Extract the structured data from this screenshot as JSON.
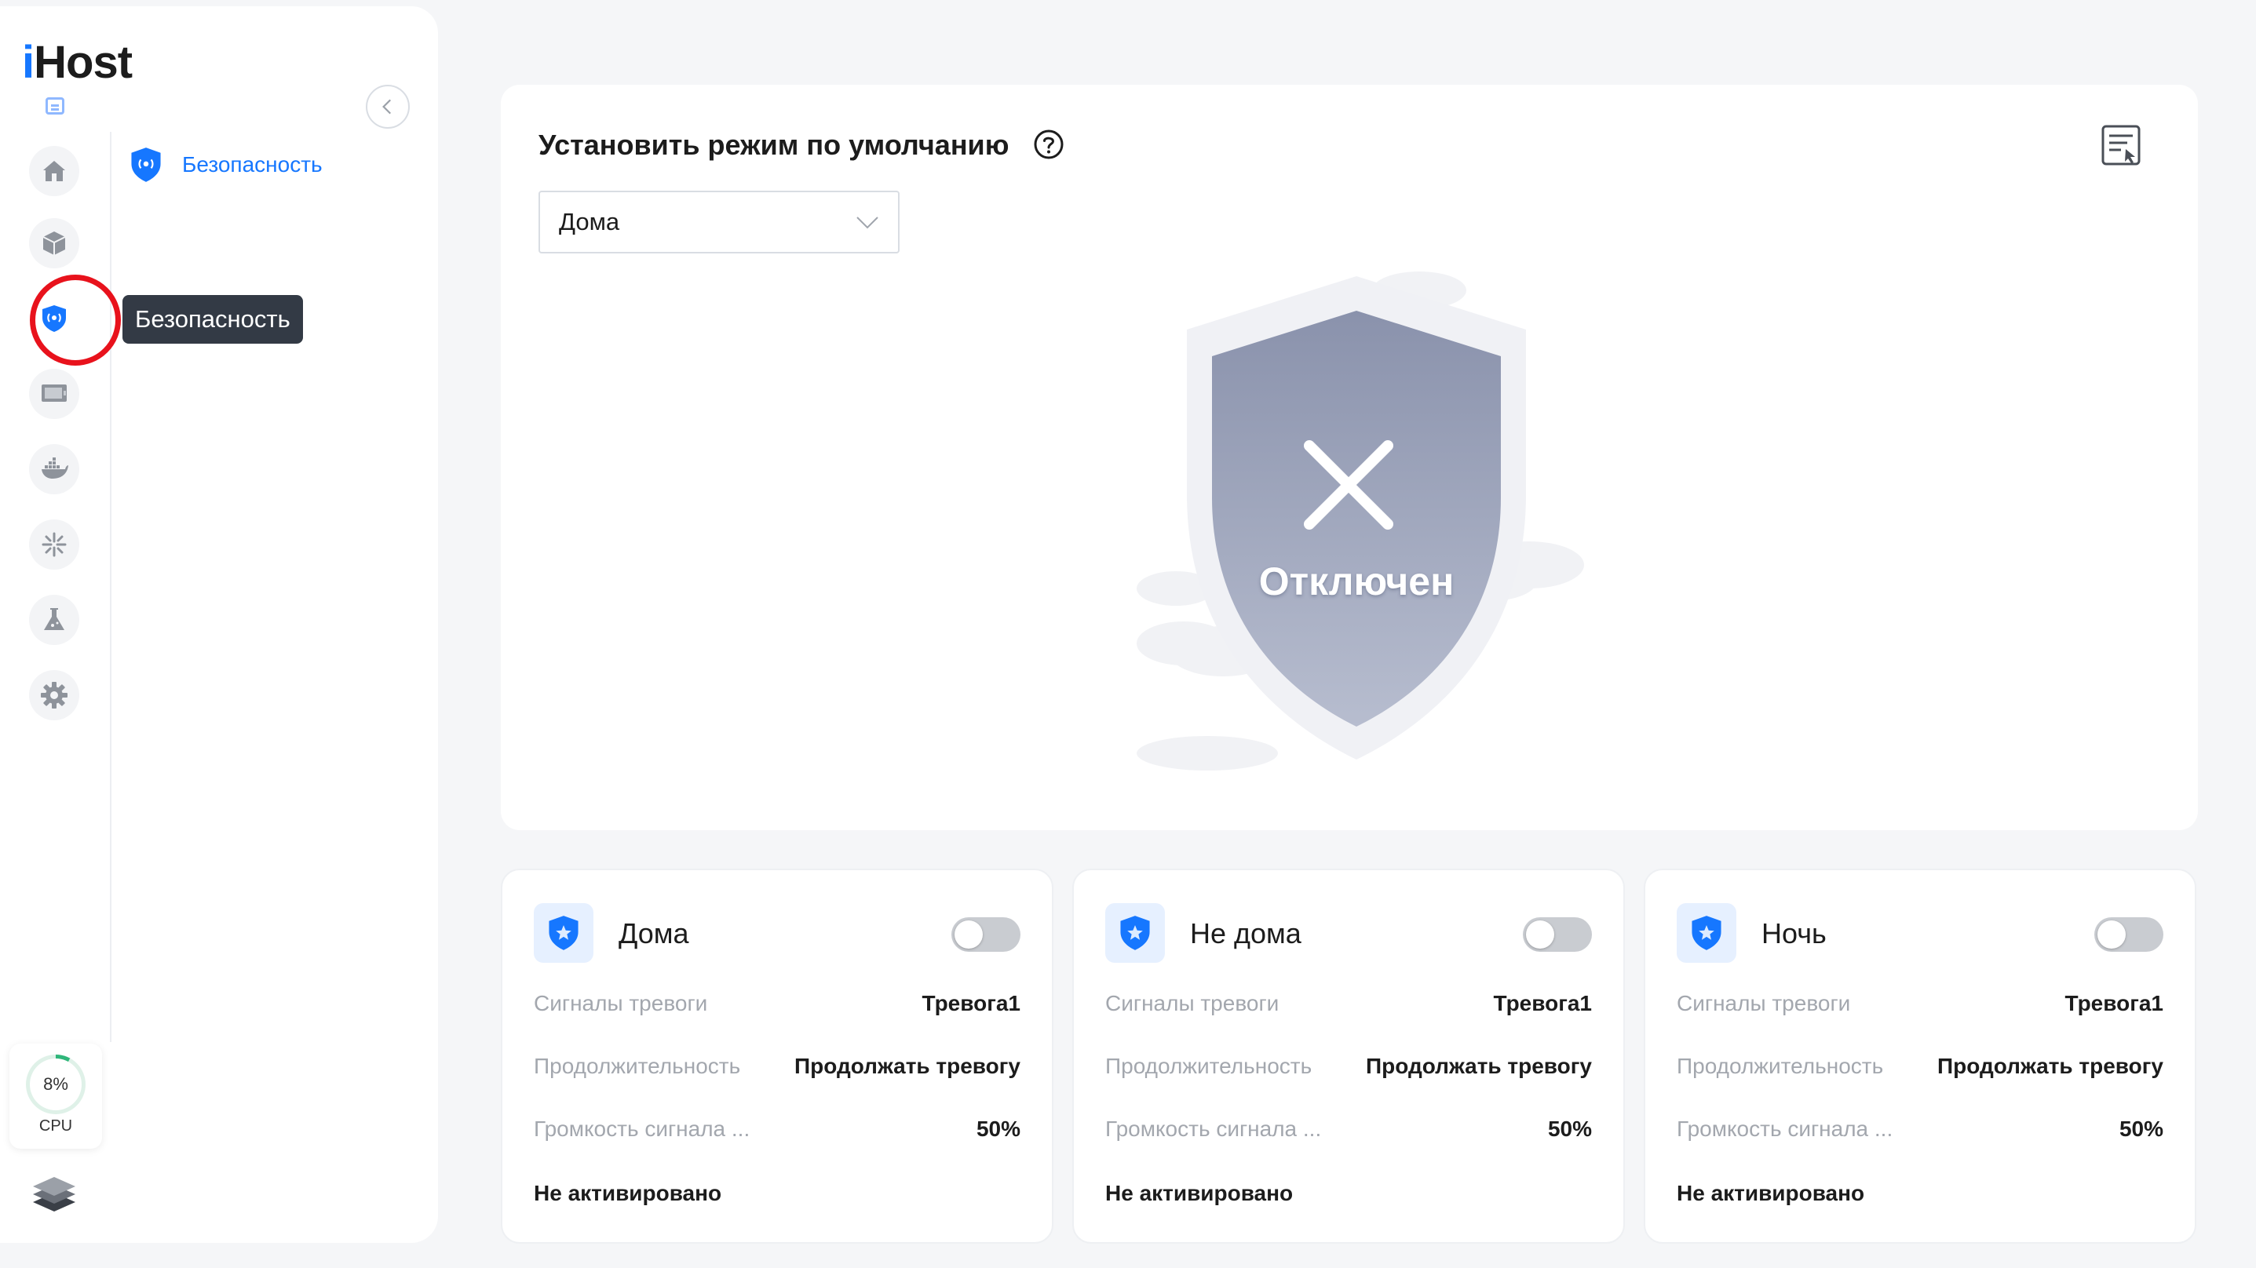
{
  "app": {
    "logo_prefix": "i",
    "logo_rest": "Host"
  },
  "sidebar": {
    "tooltip": "Безопасность",
    "sub_nav_label": "Безопасность",
    "items": [
      {
        "name": "home",
        "icon": "home-icon"
      },
      {
        "name": "devices",
        "icon": "cube-icon"
      },
      {
        "name": "security",
        "icon": "shield-icon",
        "active": true
      },
      {
        "name": "display",
        "icon": "monitor-icon"
      },
      {
        "name": "docker",
        "icon": "docker-icon"
      },
      {
        "name": "automation",
        "icon": "sparkle-icon"
      },
      {
        "name": "lab",
        "icon": "flask-icon"
      },
      {
        "name": "settings",
        "icon": "gear-icon"
      }
    ],
    "cpu": {
      "percent_text": "8%",
      "percent": 8,
      "label": "CPU"
    }
  },
  "main": {
    "title": "Установить режим по умолчанию",
    "default_mode": "Дома",
    "status_text": "Отключен"
  },
  "modes": [
    {
      "name": "Дома",
      "enabled": false,
      "alarm_label": "Сигналы тревоги",
      "alarm_value": "Тревога1",
      "duration_label": "Продолжительность",
      "duration_value": "Продолжать тревогу",
      "volume_label": "Громкость сигнала ...",
      "volume_value": "50%",
      "status": "Не активировано"
    },
    {
      "name": "Не дома",
      "enabled": false,
      "alarm_label": "Сигналы тревоги",
      "alarm_value": "Тревога1",
      "duration_label": "Продолжительность",
      "duration_value": "Продолжать тревогу",
      "volume_label": "Громкость сигнала ...",
      "volume_value": "50%",
      "status": "Не активировано"
    },
    {
      "name": "Ночь",
      "enabled": false,
      "alarm_label": "Сигналы тревоги",
      "alarm_value": "Тревога1",
      "duration_label": "Продолжительность",
      "duration_value": "Продолжать тревогу",
      "volume_label": "Громкость сигнала ...",
      "volume_value": "50%",
      "status": "Не активировано"
    }
  ],
  "colors": {
    "accent": "#1677ff",
    "highlight_ring": "#e8121c",
    "cpu_ring": "#2fb67a"
  }
}
